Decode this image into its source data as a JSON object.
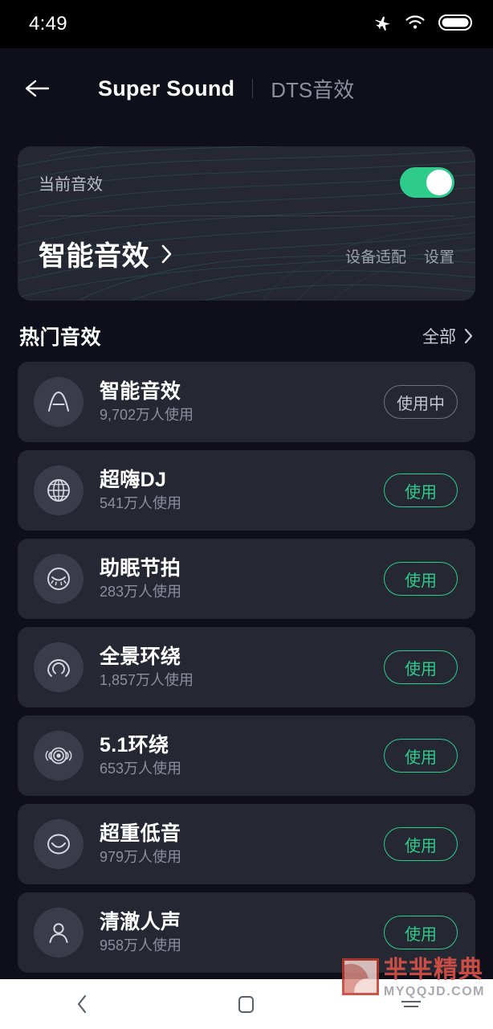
{
  "status_bar": {
    "time": "4:49",
    "icons": [
      "airplane-mode-icon",
      "wifi-icon",
      "battery-icon"
    ]
  },
  "header": {
    "back_icon": "arrow-left-icon",
    "title": "Super Sound",
    "alt_tab": "DTS音效"
  },
  "current_card": {
    "label": "当前音效",
    "toggle_on": true,
    "toggle_color": "#2ecb8b",
    "effect_name": "智能音效",
    "chevron": "chevron-right-icon",
    "actions": [
      "设备适配",
      "设置"
    ]
  },
  "section": {
    "title": "热门音效",
    "more_label": "全部",
    "more_icon": "chevron-right-icon"
  },
  "effects": [
    {
      "name": "智能音效",
      "users": "9,702万人使用",
      "icon": "smart-sound-arch-icon",
      "button": "使用中",
      "in_use": true
    },
    {
      "name": "超嗨DJ",
      "users": "541万人使用",
      "icon": "globe-disco-icon",
      "button": "使用",
      "in_use": false
    },
    {
      "name": "助眠节拍",
      "users": "283万人使用",
      "icon": "sleeping-face-icon",
      "button": "使用",
      "in_use": false
    },
    {
      "name": "全景环绕",
      "users": "1,857万人使用",
      "icon": "panoramic-surround-icon",
      "button": "使用",
      "in_use": false
    },
    {
      "name": "5.1环绕",
      "users": "653万人使用",
      "icon": "surround-speaker-icon",
      "button": "使用",
      "in_use": false
    },
    {
      "name": "超重低音",
      "users": "979万人使用",
      "icon": "bass-smile-icon",
      "button": "使用",
      "in_use": false
    },
    {
      "name": "清澈人声",
      "users": "958万人使用",
      "icon": "person-vocal-icon",
      "button": "使用",
      "in_use": false
    }
  ],
  "watermark": {
    "cn": "芈芈精典",
    "en": "MYQQJD.COM"
  },
  "nav_bar": {
    "back": "nav-back-icon",
    "home": "nav-home-icon",
    "recents": "nav-recents-icon"
  }
}
